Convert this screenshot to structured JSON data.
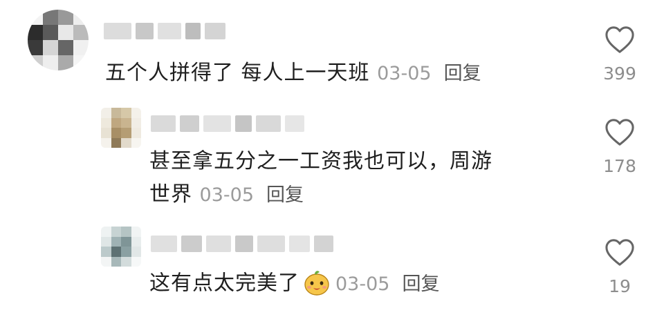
{
  "comments": [
    {
      "text": "五个人拼得了 每人上一天班",
      "date": "03-05",
      "reply_label": "回复",
      "likes": "399",
      "icon": "heart-outline-icon"
    },
    {
      "text_line1": "甚至拿五分之一工资我也可以，周游",
      "text_line2": "世界",
      "date": "03-05",
      "reply_label": "回复",
      "likes": "178",
      "icon": "heart-outline-icon"
    },
    {
      "text": "这有点太完美了",
      "emoji": "smiling-face-emoji",
      "date": "03-05",
      "reply_label": "回复",
      "likes": "19",
      "icon": "heart-outline-icon"
    }
  ]
}
